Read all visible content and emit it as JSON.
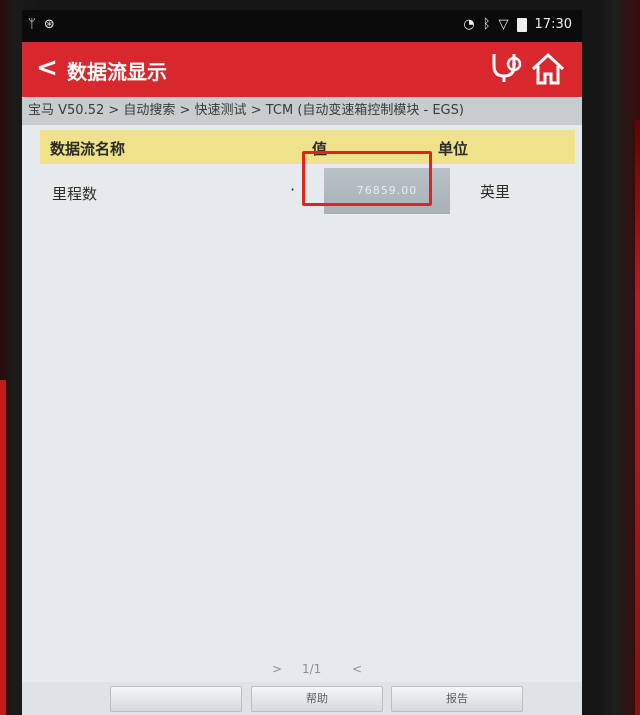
{
  "status_bar": {
    "left_icons": [
      "usb-icon",
      "sync-icon"
    ],
    "right_icons": [
      "nfc-icon",
      "bluetooth-icon",
      "wifi-icon",
      "battery-icon"
    ],
    "time": "17:30"
  },
  "header": {
    "back_label": "<",
    "title": "数据流显示",
    "icons": [
      "stethoscope-icon",
      "home-icon"
    ]
  },
  "breadcrumb": "宝马 V50.52 > 自动搜索 > 快速测试 > TCM (自动变速箱控制模块 - EGS)",
  "table": {
    "headers": {
      "name": "数据流名称",
      "value": "值",
      "unit": "单位"
    },
    "rows": [
      {
        "name": "里程数",
        "dot": "·",
        "value": "76859.00",
        "unit": "英里"
      }
    ]
  },
  "pager": {
    "prev": ">",
    "page": "1/1",
    "next": "<"
  },
  "bottom_buttons": {
    "blank": "",
    "help": "帮助",
    "report": "报告"
  },
  "colors": {
    "header_red": "#d8282e",
    "table_header_yellow": "#efe28a",
    "highlight_red": "#e3241d"
  }
}
